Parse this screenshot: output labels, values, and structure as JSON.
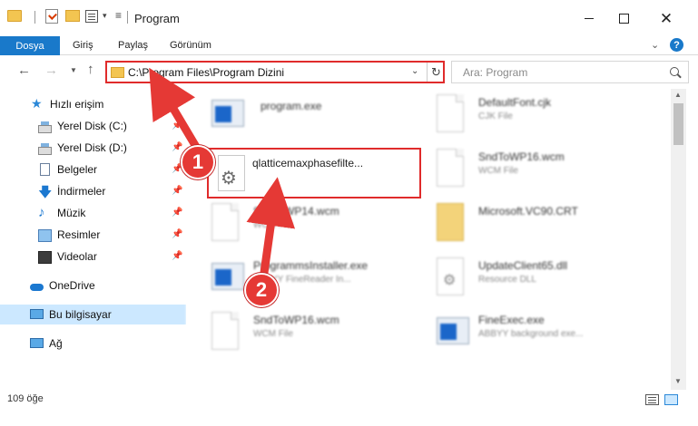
{
  "window": {
    "title": "Program",
    "buttons": {
      "minimize": "minimize",
      "maximize": "maximize",
      "close": "✕"
    }
  },
  "ribbon": {
    "tabs": [
      "Dosya",
      "Giriş",
      "Paylaş",
      "Görünüm"
    ],
    "help": "?",
    "collapse": "⌄"
  },
  "navigation": {
    "address": "C:\\Program Files\\Program Dizini",
    "search_placeholder": "Ara: Program"
  },
  "sidebar": {
    "items": [
      {
        "label": "Hızlı erişim",
        "icon": "star-icon",
        "pinned": false
      },
      {
        "label": "Yerel Disk (C:)",
        "icon": "disk-icon",
        "pinned": true
      },
      {
        "label": "Yerel Disk (D:)",
        "icon": "disk-icon",
        "pinned": true
      },
      {
        "label": "Belgeler",
        "icon": "document-icon",
        "pinned": true
      },
      {
        "label": "İndirmeler",
        "icon": "download-icon",
        "pinned": true
      },
      {
        "label": "Müzik",
        "icon": "music-icon",
        "pinned": true
      },
      {
        "label": "Resimler",
        "icon": "pictures-icon",
        "pinned": true
      },
      {
        "label": "Videolar",
        "icon": "videos-icon",
        "pinned": true
      },
      {
        "label": "OneDrive",
        "icon": "cloud-icon",
        "pinned": false
      },
      {
        "label": "Bu bilgisayar",
        "icon": "computer-icon",
        "pinned": false,
        "selected": true
      },
      {
        "label": "Ağ",
        "icon": "network-icon",
        "pinned": false
      }
    ]
  },
  "files": [
    {
      "name": "program.exe",
      "type": "",
      "icon": "exe-icon"
    },
    {
      "name": "DefaultFont.cjk",
      "type": "CJK File",
      "icon": "document-icon"
    },
    {
      "name": "qlatticemaxphasefilte...",
      "type": "",
      "icon": "dll-icon",
      "highlighted": true
    },
    {
      "name": "SndToWP16.wcm",
      "type": "WCM File",
      "icon": "document-icon"
    },
    {
      "name": "SndToWP14.wcm",
      "type": "WCM File",
      "icon": "document-icon"
    },
    {
      "name": "Microsoft.VC90.CRT",
      "type": "",
      "icon": "folder-icon"
    },
    {
      "name": "ProgrammsInstaller.exe",
      "type": "ABBYY FineReader In...",
      "icon": "exe-icon"
    },
    {
      "name": "UpdateClient65.dll",
      "type": "Resource DLL",
      "icon": "dll-icon"
    },
    {
      "name": "SndToWP16.wcm",
      "type": "WCM File",
      "icon": "document-icon"
    },
    {
      "name": "FineExec.exe",
      "type": "ABBYY background exe...",
      "icon": "exe-icon"
    }
  ],
  "status": {
    "item_count": "109 öğe"
  },
  "annotations": {
    "badge1": "1",
    "badge2": "2",
    "color": "#e53935"
  }
}
